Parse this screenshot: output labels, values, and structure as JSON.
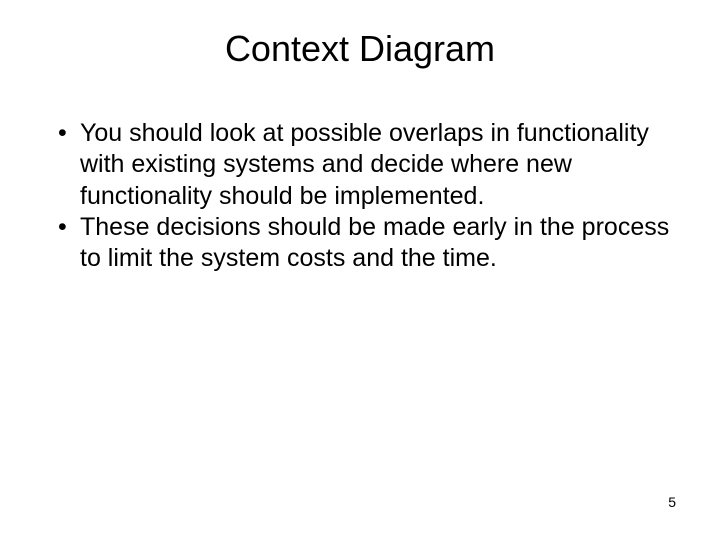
{
  "slide": {
    "title": "Context Diagram",
    "bullets": [
      "You should look at possible overlaps in functionality with existing systems and decide where new functionality should be implemented.",
      "These decisions should be made early in the process to limit the system costs and the time."
    ],
    "page_number": "5"
  }
}
